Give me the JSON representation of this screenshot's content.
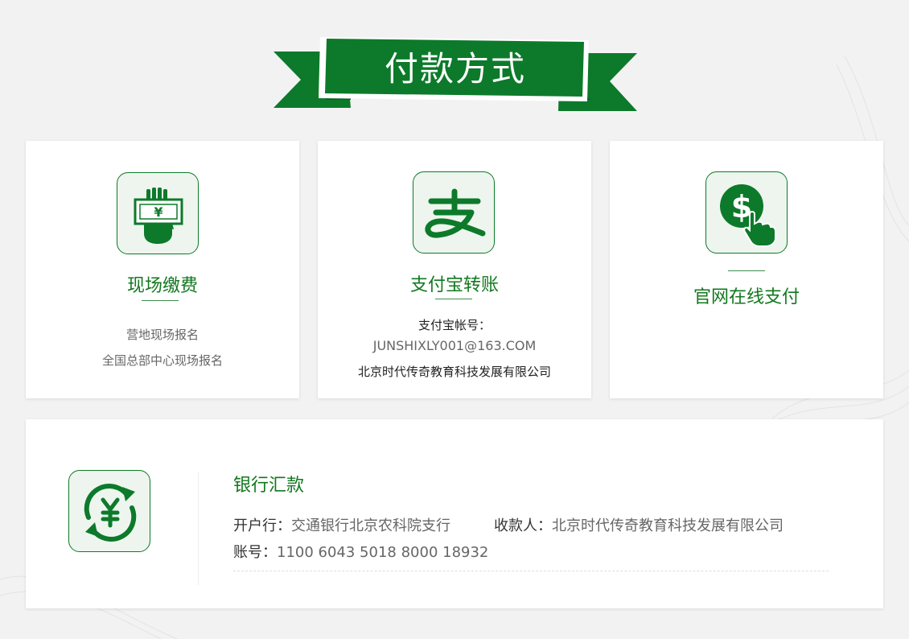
{
  "header": {
    "title": "付款方式"
  },
  "theme": {
    "accent": "#0c7a2a",
    "icon_bg": "#eef5ee",
    "page_bg": "#f3f2f2"
  },
  "cards": [
    {
      "icon": "hand-cash-icon",
      "title": "现场缴费",
      "lines": [
        "营地现场报名",
        "全国总部中心现场报名"
      ]
    },
    {
      "icon": "alipay-icon",
      "title": "支付宝转账",
      "lines": [
        "支付宝帐号：",
        "JUNSHIXLY001@163.COM",
        "北京时代传奇教育科技发展有限公司"
      ]
    },
    {
      "icon": "dollar-click-icon",
      "title": "官网在线支付",
      "lines": []
    }
  ],
  "bank": {
    "icon": "yuan-exchange-icon",
    "title": "银行汇款",
    "bank_label": "开户行：",
    "bank_value": "交通银行北京农科院支行",
    "payee_label": "收款人：",
    "payee_value": "北京时代传奇教育科技发展有限公司",
    "account_label": "账号：",
    "account_value": "1100 6043 5018 8000 18932"
  }
}
